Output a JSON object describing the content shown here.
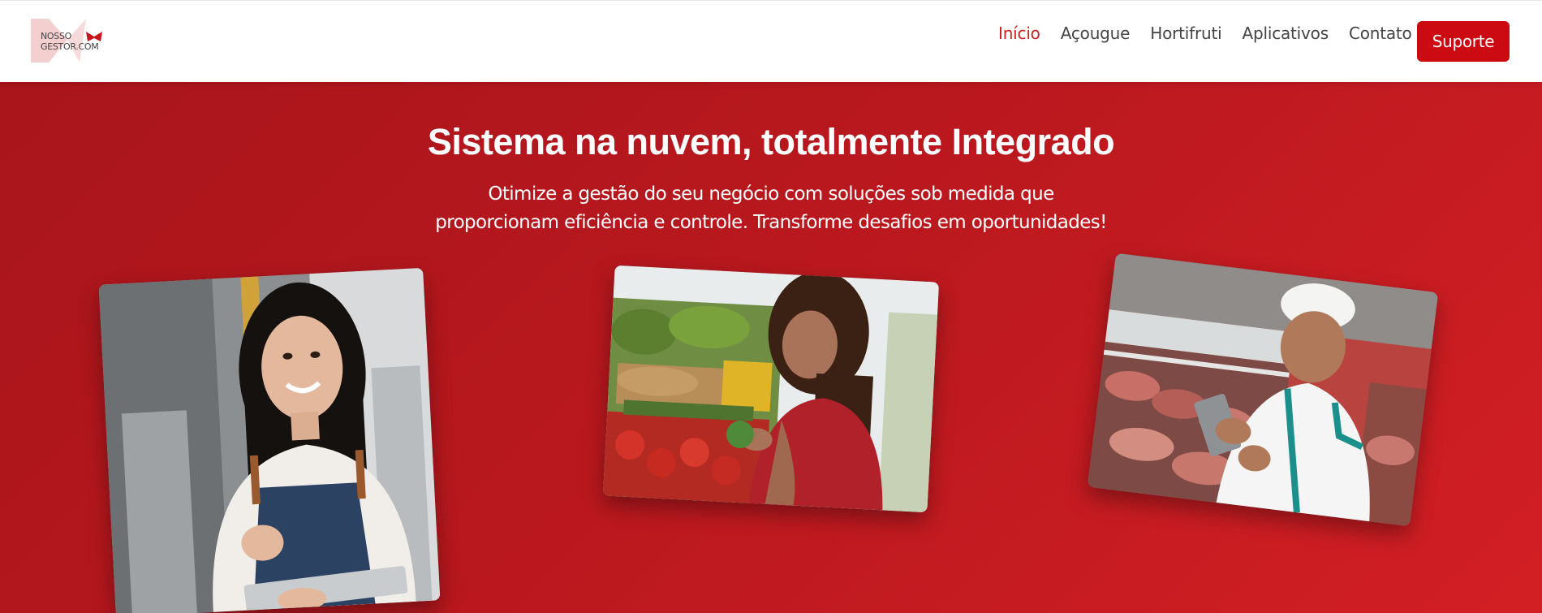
{
  "header": {
    "logo": {
      "line1": "NOSSO",
      "line2": "GESTOR.COM",
      "icon": "logo-mark-icon"
    },
    "nav": [
      {
        "label": "Início",
        "active": true
      },
      {
        "label": "Açougue",
        "active": false
      },
      {
        "label": "Hortifruti",
        "active": false
      },
      {
        "label": "Aplicativos",
        "active": false
      },
      {
        "label": "Contato",
        "active": false
      }
    ],
    "support_label": "Suporte"
  },
  "hero": {
    "title": "Sistema na nuvem, totalmente Integrado",
    "subtitle": "Otimize a gestão do seu negócio com soluções sob medida que proporcionam eficiência e controle. Transforme desafios em oportunidades!",
    "images": [
      {
        "subject": "woman-with-apron-holding-tablet"
      },
      {
        "subject": "woman-choosing-vegetables"
      },
      {
        "subject": "butcher-using-tablet"
      }
    ]
  },
  "colors": {
    "brand_red": "#cc0a12",
    "active_link": "#cc1f1f",
    "hero_start": "#a8151b",
    "hero_end": "#d21f24",
    "nav_text": "#444444"
  }
}
